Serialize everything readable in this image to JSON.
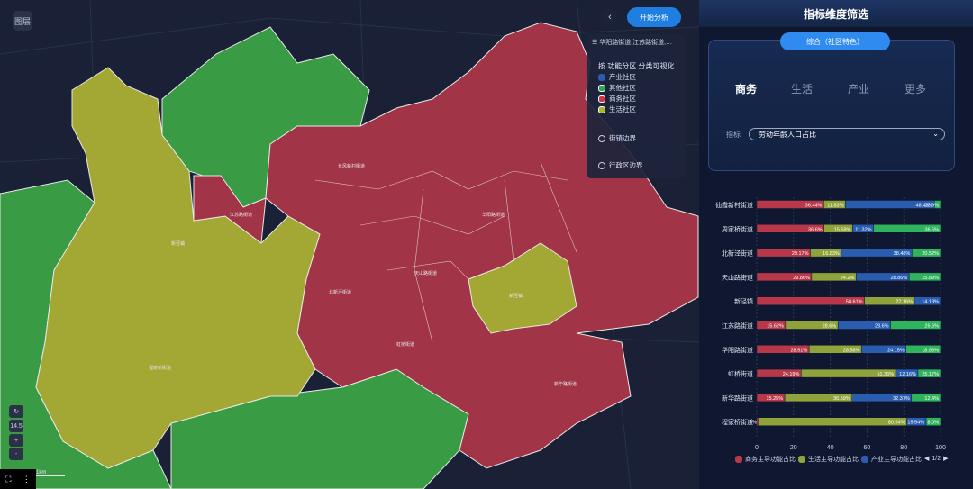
{
  "map": {
    "layers_button": "图层",
    "collapse_icon": "‹",
    "start_button": "开始分析",
    "scale_label": "1km",
    "zoom_level": "14.5",
    "zoom_in": "+",
    "zoom_out": "-",
    "bottom_icons": [
      "⛶",
      "⋮"
    ],
    "legend": {
      "title": "华阳路街道,江苏路街道,…",
      "heading": "按 功能分区 分类可视化",
      "items": [
        {
          "label": "产业社区",
          "color": "#2a5db0"
        },
        {
          "label": "其他社区",
          "color": "#2fa84f"
        },
        {
          "label": "商务社区",
          "color": "#c8384a"
        },
        {
          "label": "生活社区",
          "color": "#a6b52e"
        }
      ],
      "toggles": [
        {
          "label": "街镇边界"
        },
        {
          "label": "行政区边界"
        }
      ]
    },
    "place_labels": [
      "江苏路街道",
      "新泾镇",
      "长风新村街道",
      "北新泾街道",
      "天山路街道",
      "华阳路街道",
      "程家桥街道",
      "虹桥街道",
      "新华路街道",
      "仙霞新村街道",
      "周家桥街道",
      "程家桥街道"
    ],
    "colors": {
      "business": "#a23447",
      "life": "#a3a834",
      "other": "#3a9b45",
      "industry": "#2a5db0"
    }
  },
  "panel": {
    "title": "指标维度筛选",
    "mode_pill": "综合（社区特色）",
    "tabs": [
      "商务",
      "生活",
      "产业",
      "更多"
    ],
    "active_tab": "商务",
    "metric_label": "指标",
    "metric_value": "劳动年龄人口占比",
    "pager": "1/2"
  },
  "chart_data": {
    "type": "bar",
    "stacked": true,
    "orientation": "horizontal",
    "categories": [
      "仙霞新村街道",
      "周家桥街道",
      "北新泾街道",
      "天山路街道",
      "新泾镇",
      "江苏路街道",
      "华阳路街道",
      "虹桥街道",
      "新华路街道",
      "程家桥街道"
    ],
    "series": [
      {
        "name": "商务主导功能占比",
        "color": "#b8384a",
        "values": [
          36.44,
          36.6,
          29.17,
          29.86,
          58.61,
          15.62,
          28.51,
          24.19,
          15.25,
          1
        ],
        "labels": [
          "36.44%",
          "36.6%",
          "29.17%",
          "29.86%",
          "58.61%",
          "15.62%",
          "28.51%",
          "24.19%",
          "15.25%",
          "1%"
        ]
      },
      {
        "name": "生活主导功能占比",
        "color": "#8fa33a",
        "values": [
          11.83,
          15.58,
          16.83,
          24.2,
          27.16,
          28.6,
          28.58,
          51.36,
          36.59,
          80.64
        ],
        "labels": [
          "11.83%",
          "15.58%",
          "16.83%",
          "24.2%",
          "27.16%",
          "28.6%",
          "28.58%",
          "51.36%",
          "36.59%",
          "80.64%"
        ]
      },
      {
        "name": "产业主导功能占比",
        "color": "#2a5db0",
        "values": [
          48.43,
          11.32,
          38.48,
          28.86,
          14.18,
          28.6,
          24.15,
          12.16,
          32.37,
          10.54
        ],
        "labels": [
          "48.43%",
          "11.32%",
          "38.48%",
          "28.86%",
          "14.18%",
          "28.6%",
          "24.15%",
          "12.16%",
          "32.37%",
          "15.54%"
        ]
      },
      {
        "name": "其他",
        "color": "#2fb35c",
        "values": [
          3.3,
          36.5,
          15.52,
          17.08,
          0.05,
          27.18,
          18.72,
          12.29,
          15.79,
          7.82
        ],
        "labels": [
          "12.9%",
          "36.5%",
          "20.52%",
          "15.89%",
          "",
          "26.6%",
          "18.96%",
          "25.17%",
          "12.4%",
          "8.0%"
        ]
      }
    ],
    "xlim": [
      0,
      100
    ],
    "xticks": [
      0,
      20,
      40,
      60,
      80,
      100
    ],
    "legend_position": "bottom"
  }
}
